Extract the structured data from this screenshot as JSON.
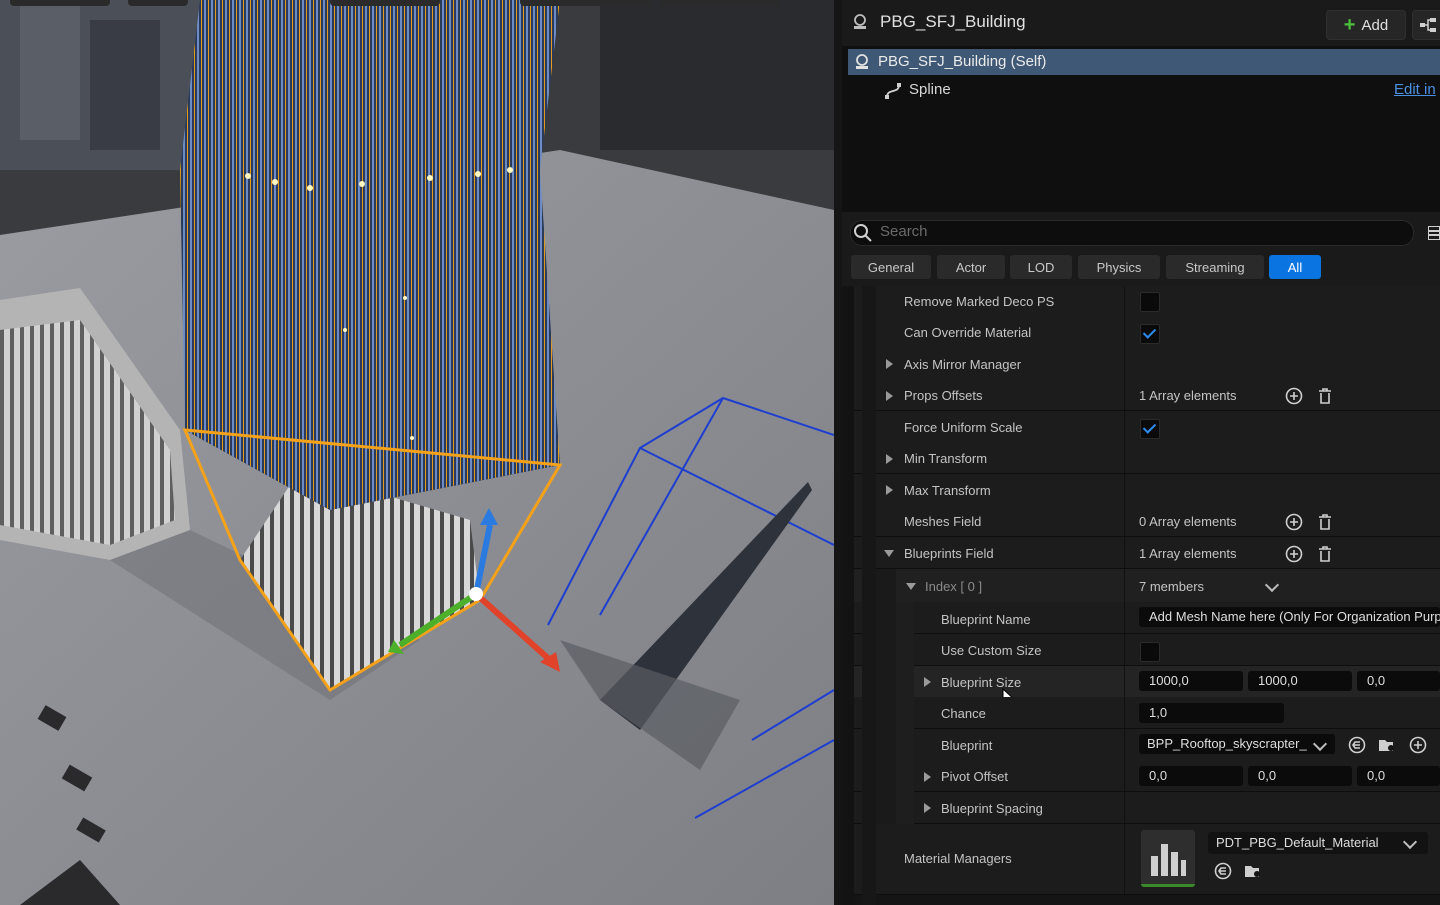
{
  "header": {
    "title": "PBG_SFJ_Building",
    "add_label": "Add"
  },
  "components": {
    "self_label": "PBG_SFJ_Building (Self)",
    "spline_label": "Spline",
    "edit_link": "Edit in"
  },
  "search": {
    "placeholder": "Search"
  },
  "tabs": [
    "General",
    "Actor",
    "LOD",
    "Physics",
    "Streaming",
    "All"
  ],
  "active_tab": "All",
  "properties": {
    "remove_marked_deco": "Remove Marked Deco PS",
    "can_override_material": "Can Override Material",
    "axis_mirror_manager": "Axis Mirror Manager",
    "props_offsets": "Props Offsets",
    "props_offsets_value": "1 Array elements",
    "force_uniform_scale": "Force Uniform Scale",
    "min_transform": "Min Transform",
    "max_transform": "Max Transform",
    "meshes_field": "Meshes Field",
    "meshes_field_value": "0 Array elements",
    "blueprints_field": "Blueprints Field",
    "blueprints_field_value": "1 Array elements",
    "index0": "Index [ 0 ]",
    "index0_value": "7 members",
    "blueprint_name": "Blueprint Name",
    "blueprint_name_value": "Add Mesh Name here (Only For Organization Purp",
    "use_custom_size": "Use Custom Size",
    "blueprint_size": "Blueprint Size",
    "blueprint_size_x": "1000,0",
    "blueprint_size_y": "1000,0",
    "blueprint_size_z": "0,0",
    "chance": "Chance",
    "chance_value": "1,0",
    "blueprint": "Blueprint",
    "blueprint_value": "BPP_Rooftop_skyscrapter_",
    "pivot_offset": "Pivot Offset",
    "pivot_x": "0,0",
    "pivot_y": "0,0",
    "pivot_z": "0,0",
    "blueprint_spacing": "Blueprint Spacing",
    "material_managers": "Material Managers",
    "material_value": "PDT_PBG_Default_Material"
  },
  "checkbox_states": {
    "remove_marked_deco": false,
    "can_override_material": true,
    "force_uniform_scale": true,
    "use_custom_size": false
  },
  "colors": {
    "accent": "#0a74e0",
    "selection": "#3f5875",
    "selection_outline": "#f5a21a",
    "gizmo_x": "#e0422a",
    "gizmo_y": "#4cb02a",
    "gizmo_z": "#2a7ae0"
  }
}
